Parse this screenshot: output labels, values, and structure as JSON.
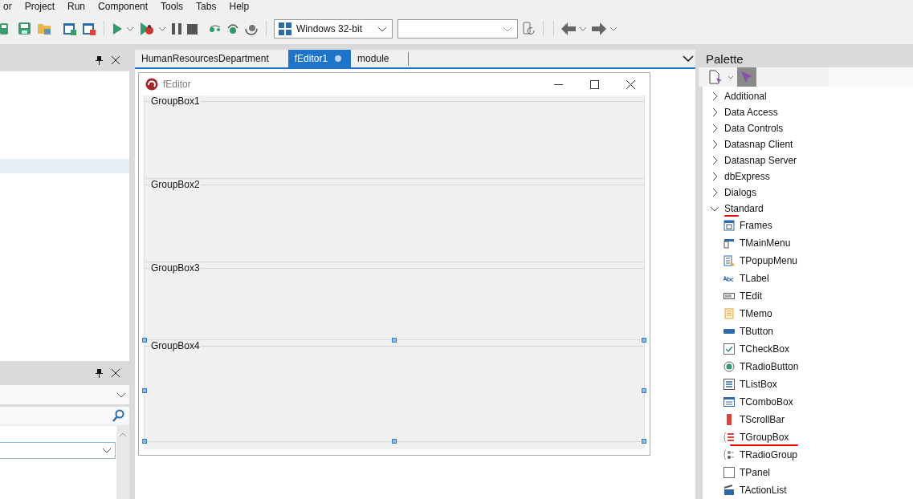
{
  "menu_bar": {
    "items": [
      "or",
      "Project",
      "Run",
      "Component",
      "Tools",
      "Tabs",
      "Help"
    ]
  },
  "toolbar": {
    "platform": "Windows 32-bit"
  },
  "editor_tabs": [
    {
      "label": "HumanResourcesDepartment",
      "selected": false,
      "modified": false
    },
    {
      "label": "fEditor1",
      "selected": true,
      "modified": true
    },
    {
      "label": "module",
      "selected": false,
      "modified": false
    }
  ],
  "form": {
    "title": "fEditor",
    "group_boxes": [
      {
        "caption": "GroupBox1",
        "selected": false
      },
      {
        "caption": "GroupBox2",
        "selected": false
      },
      {
        "caption": "GroupBox3",
        "selected": false
      },
      {
        "caption": "GroupBox4",
        "selected": true
      }
    ]
  },
  "palette": {
    "title": "Palette",
    "categories": [
      {
        "label": "Additional",
        "expanded": false
      },
      {
        "label": "Data Access",
        "expanded": false
      },
      {
        "label": "Data Controls",
        "expanded": false
      },
      {
        "label": "Datasnap Client",
        "expanded": false
      },
      {
        "label": "Datasnap Server",
        "expanded": false
      },
      {
        "label": "dbExpress",
        "expanded": false
      },
      {
        "label": "Dialogs",
        "expanded": false
      },
      {
        "label": "Standard",
        "expanded": true,
        "marked": true,
        "children": [
          {
            "label": "Frames",
            "kind": "frames",
            "marked": false
          },
          {
            "label": "TMainMenu",
            "kind": "mainmenu",
            "marked": false
          },
          {
            "label": "TPopupMenu",
            "kind": "popupmenu",
            "marked": false
          },
          {
            "label": "TLabel",
            "kind": "label",
            "marked": false
          },
          {
            "label": "TEdit",
            "kind": "edit",
            "marked": false
          },
          {
            "label": "TMemo",
            "kind": "memo",
            "marked": false
          },
          {
            "label": "TButton",
            "kind": "button",
            "marked": false
          },
          {
            "label": "TCheckBox",
            "kind": "checkbox",
            "marked": false
          },
          {
            "label": "TRadioButton",
            "kind": "radio",
            "marked": false
          },
          {
            "label": "TListBox",
            "kind": "listbox",
            "marked": false
          },
          {
            "label": "TComboBox",
            "kind": "combobox",
            "marked": false
          },
          {
            "label": "TScrollBar",
            "kind": "scrollbar",
            "marked": false
          },
          {
            "label": "TGroupBox",
            "kind": "groupbox",
            "marked": true
          },
          {
            "label": "TRadioGroup",
            "kind": "radiogroup",
            "marked": false
          },
          {
            "label": "TPanel",
            "kind": "panel",
            "marked": false
          },
          {
            "label": "TActionList",
            "kind": "actionlist",
            "marked": false
          }
        ]
      }
    ]
  }
}
